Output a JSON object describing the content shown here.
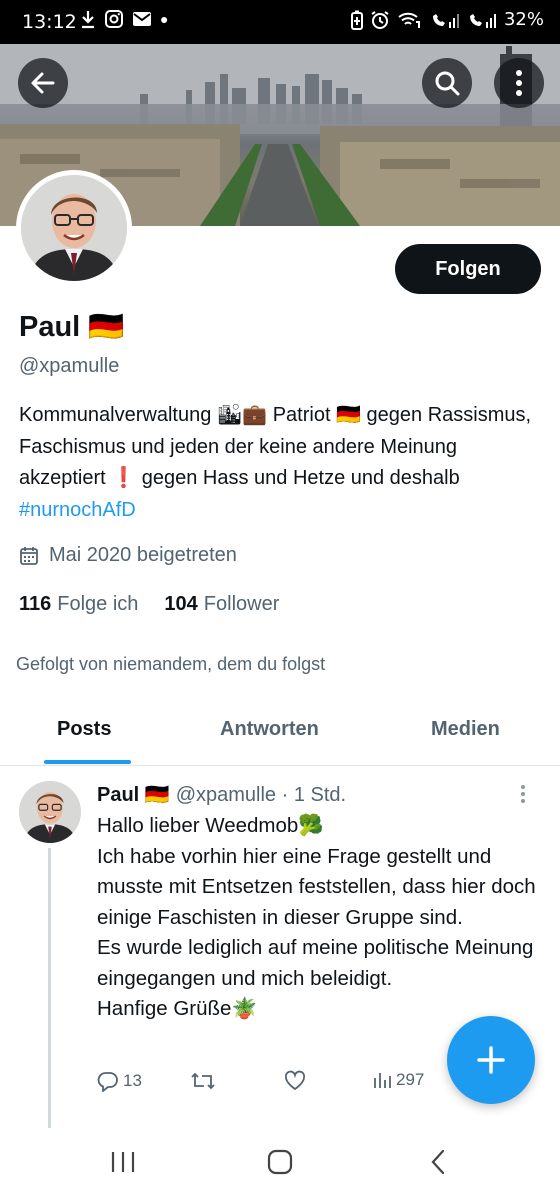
{
  "status_bar": {
    "time": "13:12",
    "battery": "32%",
    "left_icons": [
      "download-icon",
      "instagram-icon",
      "mail-icon",
      "dot-icon"
    ],
    "right_icons": [
      "battery-saver-icon",
      "alarm-icon",
      "wifi-call-icon",
      "volte-signal-icon",
      "signal-icon"
    ]
  },
  "header": {
    "back_icon": "arrow-left-icon",
    "search_icon": "search-icon",
    "more_icon": "more-vertical-icon"
  },
  "profile": {
    "follow_label": "Folgen",
    "name": "Paul 🇩🇪",
    "handle": "@xpamulle",
    "bio_text": "Kommunalverwaltung 🏙💼 Patriot 🇩🇪 gegen Rassismus, Faschismus und jeden der keine andere Meinung akzeptiert ❗ gegen Hass und Hetze und deshalb ",
    "bio_hashtag": "#nurnochAfD",
    "joined": "Mai 2020 beigetreten",
    "following_count": "116",
    "following_label": "Folge ich",
    "followers_count": "104",
    "followers_label": "Follower",
    "followed_by": "Gefolgt von niemandem, dem du folgst"
  },
  "tabs": [
    {
      "label": "Posts",
      "active": true
    },
    {
      "label": "Antworten",
      "active": false
    },
    {
      "label": "Medien",
      "active": false
    }
  ],
  "post": {
    "author": "Paul 🇩🇪",
    "meta": "@xpamulle · 1 Std.",
    "text": "Hallo lieber Weedmob🥦\nIch habe vorhin hier eine Frage gestellt und musste mit Entsetzen feststellen, dass hier doch einige Faschisten in dieser Gruppe sind.\nEs wurde lediglich auf meine politische Meinung eingegangen und mich beleidigt.\nHanfige Grüße🪴",
    "replies": "13",
    "retweets": "",
    "likes": "",
    "views": "297"
  },
  "fab_label": "+",
  "colors": {
    "accent": "#1d9bf0",
    "text": "#0f1419",
    "muted": "#536471",
    "follow_bg": "#0f1419"
  }
}
